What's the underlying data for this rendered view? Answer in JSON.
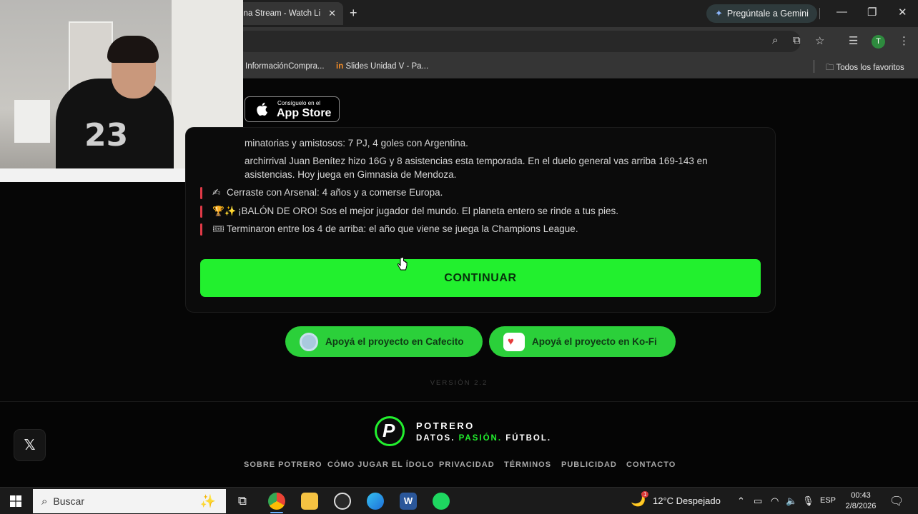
{
  "browser": {
    "tab_title": "ina Stream - Watch Li",
    "tab_close": "✕",
    "new_tab": "+",
    "gemini_label": "Pregúntale a Gemini",
    "profile_initial": "T",
    "bookmarks": [
      {
        "label": "InformaciónCompra..."
      },
      {
        "label": "Slides Unidad V - Pa..."
      }
    ],
    "all_bookmarks": "Todos los favoritos"
  },
  "appstore": {
    "small": "Consíguelo en el",
    "big": "App Store"
  },
  "card": {
    "lines": [
      {
        "text": "minatorias y amistosos: 7 PJ, 4 goles con Argentina."
      },
      {
        "text": "archirrival Juan Benítez hizo 16G y 8 asistencias esta temporada. En el duelo general vas arriba 169-143 en"
      },
      {
        "text": "asistencias. Hoy juega en Gimnasia de Mendoza."
      },
      {
        "emoji": "✍",
        "text": "Cerraste con Arsenal: 4 años y a comerse Europa."
      },
      {
        "emoji": "🏆✨",
        "text": "¡BALÓN DE ORO! Sos el mejor jugador del mundo. El planeta entero se rinde a tus pies."
      },
      {
        "emoji": "🎟",
        "text": "Terminaron entre los 4 de arriba: el año que viene se juega la Champions League."
      }
    ],
    "continue_label": "CONTINUAR"
  },
  "support": {
    "cafecito": "Apoyá el proyecto en Cafecito",
    "kofi": "Apoyá el proyecto en Ko-Fi"
  },
  "version": "VERSIÓN 2.2",
  "footer": {
    "brand": "POTRERO",
    "tagline_1": "DATOS.",
    "tagline_2": "PASIÓN.",
    "tagline_3": "FÚTBOL.",
    "logo_letter": "P",
    "nav": [
      "SOBRE POTRERO",
      "CÓMO JUGAR EL ÍDOLO",
      "PRIVACIDAD",
      "TÉRMINOS",
      "PUBLICIDAD",
      "CONTACTO"
    ],
    "x_label": "𝕏"
  },
  "taskbar": {
    "search_label": "Buscar",
    "weather": "12°C  Despejado",
    "lang": "ESP",
    "time": "00:43",
    "date": "2/8/2026",
    "weather_badge": "1"
  },
  "colors": {
    "accent_green": "#22f02e",
    "support_green": "#2bd03a",
    "bar_red": "#e03a47"
  },
  "icons": {
    "gemini": "sparkle-icon",
    "minimize": "minimize-icon",
    "restore": "restore-icon",
    "close": "close-icon",
    "zoom": "magnifier-icon",
    "cast": "cast-icon",
    "star": "star-icon",
    "menu": "kebab-icon"
  }
}
